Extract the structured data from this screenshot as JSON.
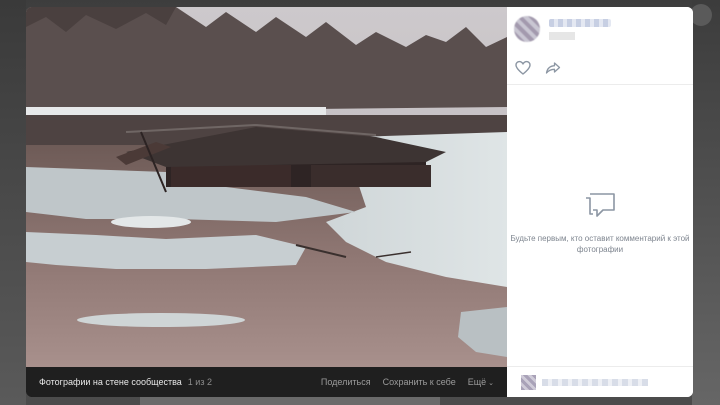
{
  "footer": {
    "album_link": "Фотографии на стене сообщества",
    "counter": "1 из 2",
    "share_label": "Поделиться",
    "save_label": "Сохранить к себе",
    "more_label": "Ещё"
  },
  "side": {
    "empty_comments_text": "Будьте первым, кто оставит комментарий к этой фотографии"
  },
  "icons": {
    "like": "heart-icon",
    "share": "share-arrow-icon",
    "comments": "comment-bubble-icon"
  },
  "colors": {
    "icon_gray": "#8c96a3",
    "footer_bg": "#1f1f1f"
  }
}
